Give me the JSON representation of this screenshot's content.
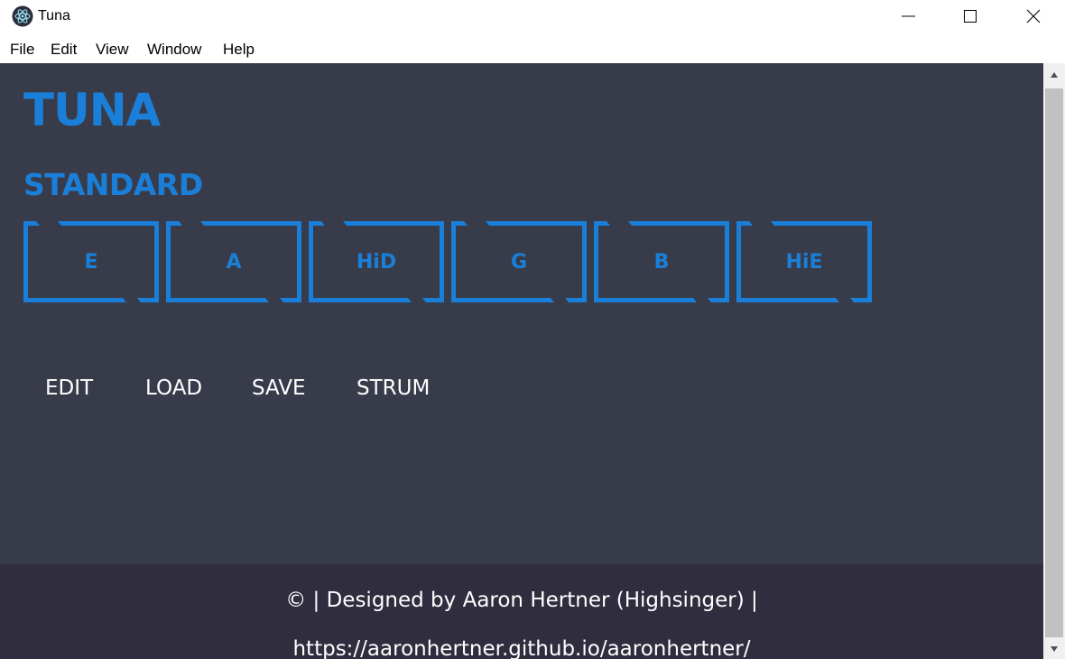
{
  "window": {
    "title": "Tuna",
    "icon": "electron-atom-icon"
  },
  "menu": {
    "items": [
      "File",
      "Edit",
      "View",
      "Window",
      "Help"
    ]
  },
  "app": {
    "title": "TUNA",
    "tuning_name": "STANDARD",
    "strings": [
      "E",
      "A",
      "HiD",
      "G",
      "B",
      "HiE"
    ],
    "actions": [
      "EDIT",
      "LOAD",
      "SAVE",
      "STRUM"
    ]
  },
  "footer": {
    "line1": "© | Designed by Aaron Hertner (Highsinger) |",
    "line2": "https://aaronhertner.github.io/aaronhertner/"
  },
  "colors": {
    "accent": "#1a7fd8",
    "content_bg": "#383c4a",
    "footer_bg": "#2f2d3e",
    "text_light": "#ffffff"
  }
}
